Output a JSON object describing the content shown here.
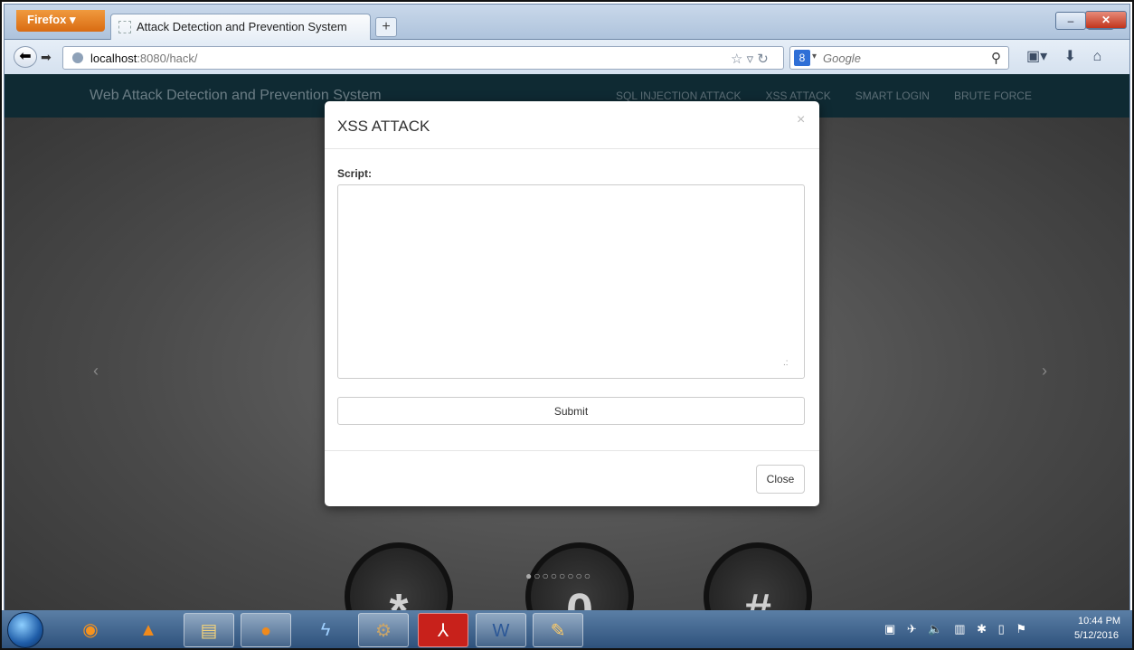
{
  "browser": {
    "menu_button": "Firefox",
    "tab_title": "Attack Detection and Prevention System",
    "new_tab": "+",
    "url_host": "localhost",
    "url_rest": ":8080/hack/",
    "search_engine_letter": "8",
    "search_placeholder": "Google",
    "window_controls": {
      "minimize": "–",
      "maximize": "❐",
      "close": "✕"
    }
  },
  "site": {
    "brand": "Web Attack Detection and Prevention System",
    "menu": [
      "SQL INJECTION ATTACK",
      "XSS ATTACK",
      "SMART LOGIN",
      "BRUTE FORCE"
    ],
    "carousel_prev": "‹",
    "carousel_next": "›",
    "keypad": [
      "*",
      "0",
      "#"
    ]
  },
  "modal": {
    "title": "XSS ATTACK",
    "close_x": "×",
    "script_label": "Script:",
    "script_value": "",
    "submit_label": "Submit",
    "close_label": "Close"
  },
  "taskbar": {
    "apps": [
      "media-player-icon",
      "vlc-icon",
      "file-explorer-icon",
      "firefox-icon",
      "lightning-app-icon",
      "gear-app-icon",
      "adobe-reader-icon",
      "word-icon",
      "paint-icon"
    ],
    "clock_time": "10:44 PM",
    "clock_date": "5/12/2016"
  },
  "colors": {
    "site_navbar": "#0f2a33",
    "firefox_orange": "#e07a22",
    "taskbar": "#2c4f79"
  }
}
